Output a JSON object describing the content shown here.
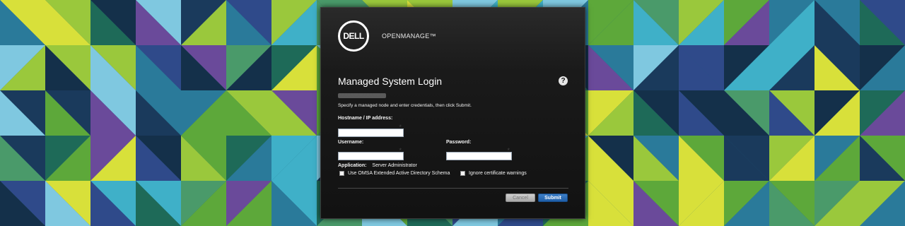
{
  "brand": {
    "logo_text": "DELL",
    "product_name": "OPENMANAGE™"
  },
  "dialog": {
    "title": "Managed System Login",
    "help_label": "?",
    "instruction": "Specify a managed node and enter credentials, then click Submit."
  },
  "form": {
    "hostname_label": "Hostname / IP address:",
    "hostname_value": "",
    "username_label": "Username:",
    "username_value": "",
    "password_label": "Password:",
    "password_value": "",
    "required_marker": "*",
    "application_label": "Application:",
    "application_value": "Server Administrator",
    "checkbox_omsa_label": "Use OMSA Extended Active Directory Schema",
    "checkbox_omsa_checked": false,
    "checkbox_cert_label": "Ignore certificate warnings",
    "checkbox_cert_checked": false
  },
  "buttons": {
    "cancel_label": "Cancel",
    "submit_label": "Submit"
  },
  "colors": {
    "dialog_background": "#1a1a1a",
    "submit_button": "#2a6fbb",
    "cancel_button": "#bdbdbd",
    "background_palette": [
      "#1a3a5c",
      "#2a7a9a",
      "#3fb0c8",
      "#7fc8e0",
      "#5da83a",
      "#9ac83c",
      "#d8e03a",
      "#1e6a58",
      "#2f4a8a",
      "#6a4a9a",
      "#14304a",
      "#4a9a6a"
    ]
  }
}
